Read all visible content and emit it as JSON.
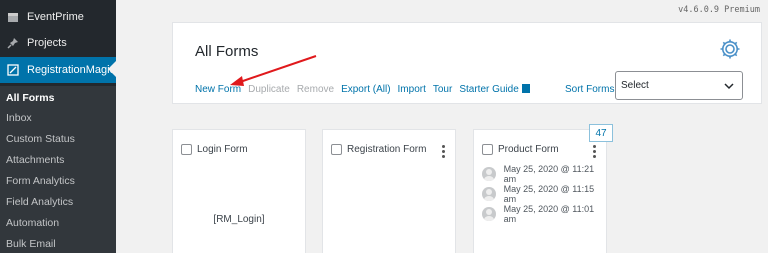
{
  "version": "v4.6.0.9 Premium",
  "sidebar": {
    "menu": [
      {
        "label": "EventPrime"
      },
      {
        "label": "Projects"
      },
      {
        "label": "RegistrationMagic"
      }
    ],
    "submenu": [
      {
        "label": "All Forms"
      },
      {
        "label": "Inbox"
      },
      {
        "label": "Custom Status"
      },
      {
        "label": "Attachments"
      },
      {
        "label": "Form Analytics"
      },
      {
        "label": "Field Analytics"
      },
      {
        "label": "Automation"
      },
      {
        "label": "Bulk Email"
      }
    ]
  },
  "header": {
    "title": "All Forms",
    "toolbar": {
      "new_form": "New Form",
      "duplicate": "Duplicate",
      "remove": "Remove",
      "export": "Export (All)",
      "import": "Import",
      "tour": "Tour",
      "starter_guide": "Starter Guide"
    },
    "sort_label": "Sort Forms",
    "sort_value": "Select"
  },
  "cards": [
    {
      "title": "Login Form",
      "shortcode": "[RM_Login]"
    },
    {
      "title": "Registration Form"
    },
    {
      "title": "Product Form",
      "badge": "47",
      "submissions": [
        "May 25, 2020 @ 11:21 am",
        "May 25, 2020 @ 11:15 am",
        "May 25, 2020 @ 11:01 am"
      ]
    }
  ],
  "colors": {
    "sidebar_bg": "#23282d",
    "active_bg": "#0073aa",
    "link": "#0073aa",
    "arrow": "#e0191c"
  }
}
